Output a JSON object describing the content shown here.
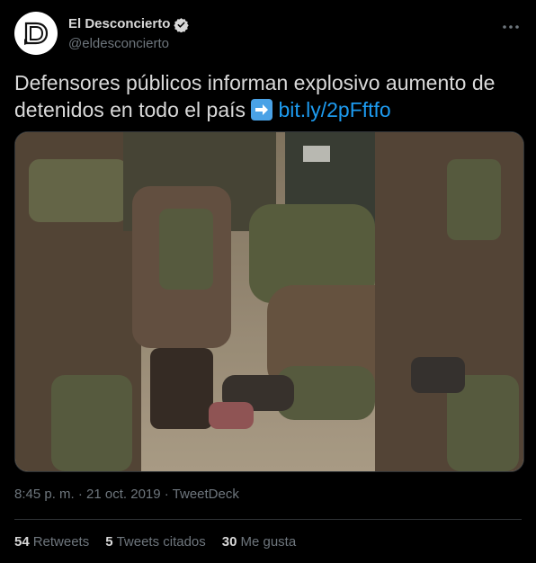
{
  "account": {
    "display_name": "El Desconcierto",
    "handle": "@eldesconcierto",
    "verified_icon": "verified-badge-icon",
    "avatar_logo": "D"
  },
  "tweet": {
    "text_line_1": "Defensores públicos informan explosivo aumento de",
    "text_line_2": "detenidos en todo el país",
    "emoji": "right-arrow-emoji",
    "link": "bit.ly/2pFftfo",
    "media_icon": "photo-police-detention"
  },
  "meta": {
    "timestamp": "8:45 p. m. · 21 oct. 2019 · TweetDeck"
  },
  "stats": {
    "retweets_count": "54",
    "retweets_label": "Retweets",
    "quotes_count": "5",
    "quotes_label": "Tweets citados",
    "likes_count": "30",
    "likes_label": "Me gusta"
  },
  "colors": {
    "background": "#000000",
    "text": "#d9d9d9",
    "secondary": "#6e767d",
    "link": "#1d9bf0",
    "divider": "#2f3336"
  }
}
